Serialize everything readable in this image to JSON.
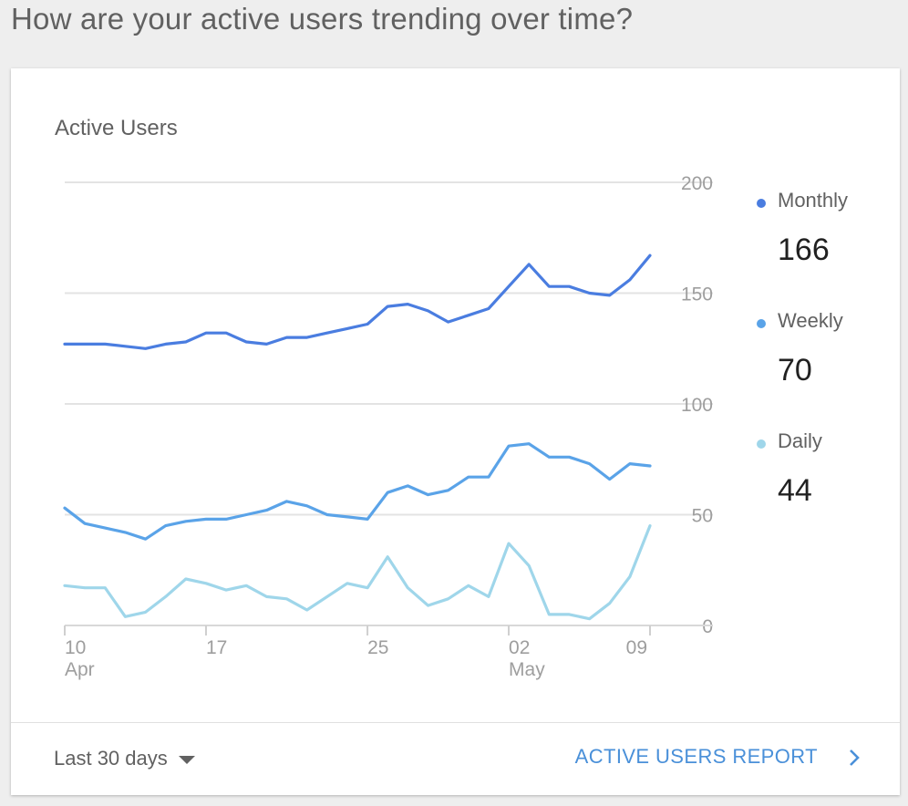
{
  "page": {
    "question": "How are your active users trending over time?"
  },
  "card": {
    "title": "Active Users",
    "date_range": "Last 30 days",
    "report_link": "ACTIVE USERS REPORT"
  },
  "legend": [
    {
      "name": "Monthly",
      "value": "166",
      "color": "#4a7de0"
    },
    {
      "name": "Weekly",
      "value": "70",
      "color": "#5aa3e8"
    },
    {
      "name": "Daily",
      "value": "44",
      "color": "#9fd6ea"
    }
  ],
  "chart_data": {
    "type": "line",
    "title": "Active Users",
    "x": [
      "10 Apr",
      "11 Apr",
      "12 Apr",
      "13 Apr",
      "14 Apr",
      "15 Apr",
      "16 Apr",
      "17 Apr",
      "18 Apr",
      "19 Apr",
      "20 Apr",
      "21 Apr",
      "22 Apr",
      "23 Apr",
      "24 Apr",
      "25 Apr",
      "26 Apr",
      "27 Apr",
      "28 Apr",
      "29 Apr",
      "30 Apr",
      "01 May",
      "02 May",
      "03 May",
      "04 May",
      "05 May",
      "06 May",
      "07 May",
      "08 May",
      "09 May"
    ],
    "x_ticks": [
      {
        "label": "10",
        "sub": "Apr",
        "index": 0
      },
      {
        "label": "17",
        "sub": "",
        "index": 7
      },
      {
        "label": "25",
        "sub": "",
        "index": 15
      },
      {
        "label": "02",
        "sub": "May",
        "index": 22
      },
      {
        "label": "09",
        "sub": "",
        "index": 29
      }
    ],
    "panels": [
      {
        "ylim": [
          100,
          200
        ],
        "ticks": [
          200,
          150,
          100
        ],
        "series": [
          "Monthly"
        ]
      },
      {
        "ylim": [
          0,
          100
        ],
        "ticks": [
          50,
          0
        ],
        "series": [
          "Weekly",
          "Daily"
        ]
      }
    ],
    "series": [
      {
        "name": "Monthly",
        "color": "#4a7de0",
        "values": [
          127,
          127,
          127,
          126,
          125,
          127,
          128,
          132,
          132,
          128,
          127,
          130,
          130,
          132,
          134,
          136,
          144,
          145,
          142,
          137,
          140,
          143,
          153,
          163,
          153,
          153,
          150,
          149,
          156,
          167
        ]
      },
      {
        "name": "Weekly",
        "color": "#5aa3e8",
        "values": [
          53,
          46,
          44,
          42,
          39,
          45,
          47,
          48,
          48,
          50,
          52,
          56,
          54,
          50,
          49,
          48,
          60,
          63,
          59,
          61,
          67,
          67,
          81,
          82,
          76,
          76,
          73,
          66,
          73,
          72
        ]
      },
      {
        "name": "Daily",
        "color": "#9fd6ea",
        "values": [
          18,
          17,
          17,
          4,
          6,
          13,
          21,
          19,
          16,
          18,
          13,
          12,
          7,
          13,
          19,
          17,
          31,
          17,
          9,
          12,
          18,
          13,
          37,
          27,
          5,
          5,
          3,
          10,
          22,
          45
        ]
      }
    ],
    "grid": true,
    "legend_position": "right"
  }
}
